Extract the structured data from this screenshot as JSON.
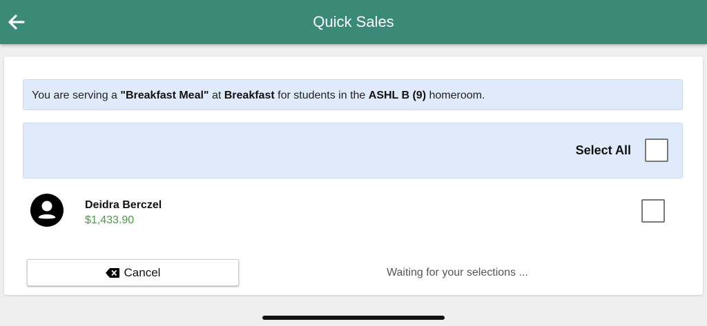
{
  "header": {
    "title": "Quick Sales",
    "back_icon": "arrow-left-icon",
    "color": "#3b8a78"
  },
  "info": {
    "prefix": "You are serving a ",
    "meal": "\"Breakfast Meal\"",
    "at": " at ",
    "period": "Breakfast",
    "middle": " for students in the ",
    "homeroom": "ASHL B (9)",
    "suffix": " homeroom."
  },
  "select_all": {
    "label": "Select All"
  },
  "students": [
    {
      "name": "Deidra Berczel",
      "balance": "$1,433.90",
      "avatar_icon": "user-avatar-icon"
    }
  ],
  "footer": {
    "cancel_label": "Cancel",
    "cancel_icon": "backspace-x-icon",
    "status": "Waiting for your selections ..."
  },
  "colors": {
    "accent": "#3b8a78",
    "balance": "#4a9a45",
    "info_bg": "#dfebfb"
  }
}
